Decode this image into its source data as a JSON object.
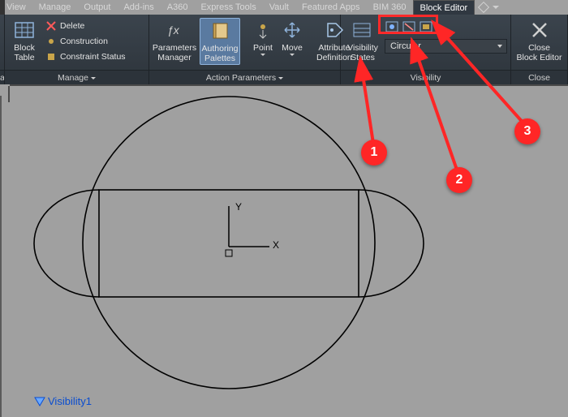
{
  "tabs": {
    "t0": "View",
    "t1": "Manage",
    "t2": "Output",
    "t3": "Add-ins",
    "t4": "A360",
    "t5": "Express Tools",
    "t6": "Vault",
    "t7": "Featured Apps",
    "t8": "BIM 360",
    "active": "Block Editor"
  },
  "leftPanelTrunc": "al",
  "panels": {
    "manage": {
      "title": "Manage",
      "blockTable": "Block\nTable",
      "delete": "Delete",
      "construction": "Construction",
      "constraintStatus": "Constraint Status"
    },
    "fx": {
      "parametersManager": "Parameters\nManager",
      "authoringPalettes": "Authoring\nPalettes"
    },
    "actionParameters": {
      "title": "Action Parameters",
      "point": "Point",
      "move": "Move",
      "attributeDefinition": "Attribute\nDefinition"
    },
    "visibility": {
      "title": "Visibility",
      "visibilityStates": "Visibility\nStates",
      "dropdown": "Circular"
    },
    "close": {
      "title": "Close",
      "closeBlockEditor": "Close\nBlock Editor"
    }
  },
  "drawing": {
    "axisX": "X",
    "axisY": "Y",
    "visibilityGrip": "Visibility1"
  },
  "callouts": {
    "c1": "1",
    "c2": "2",
    "c3": "3"
  }
}
